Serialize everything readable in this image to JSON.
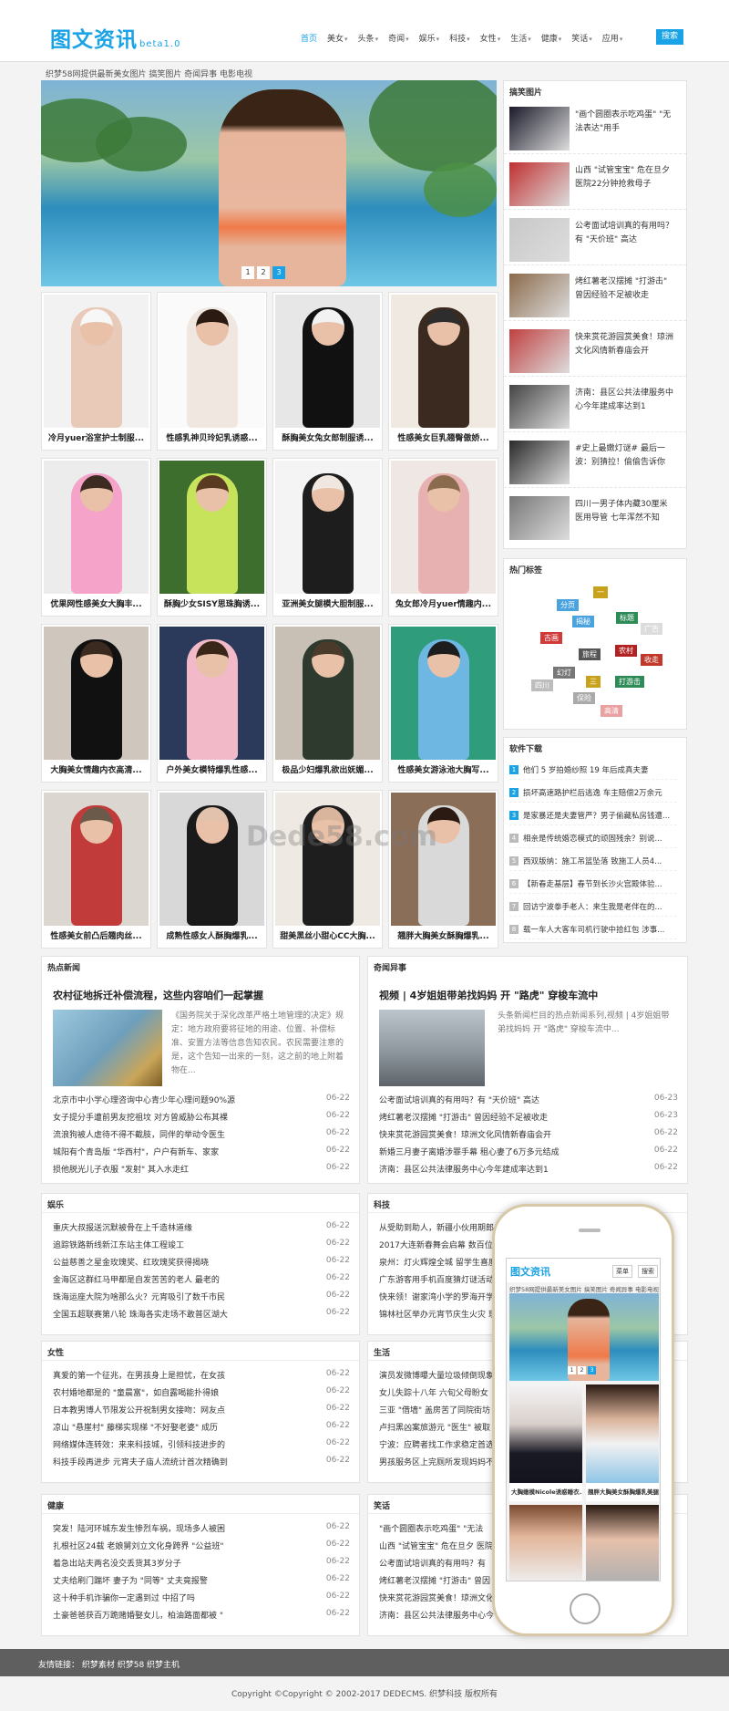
{
  "header": {
    "logo": "图文资讯",
    "version": "beta1.0",
    "search": "搜索",
    "nav": [
      {
        "label": "首页",
        "on": true
      },
      {
        "label": "美女",
        "dd": true
      },
      {
        "label": "头条",
        "dd": true
      },
      {
        "label": "奇闻",
        "dd": true
      },
      {
        "label": "娱乐",
        "dd": true
      },
      {
        "label": "科技",
        "dd": true
      },
      {
        "label": "女性",
        "dd": true
      },
      {
        "label": "生活",
        "dd": true
      },
      {
        "label": "健康",
        "dd": true
      },
      {
        "label": "笑话",
        "dd": true
      },
      {
        "label": "应用",
        "dd": true
      }
    ]
  },
  "tagline": "织梦58网提供最新美女图片 搞笑图片 奇闻异事 电影电视",
  "slider": {
    "pages": [
      "1",
      "2",
      "3"
    ],
    "active": "3"
  },
  "grid": [
    "冷月yuer浴室护士制服...",
    "性感乳神贝玲妃乳诱惑...",
    "酥胸美女兔女郎制服诱...",
    "性感美女巨乳翘臀傲娇...",
    "优果网性感美女大胸丰...",
    "酥胸少女SISY思珠胸诱...",
    "亚洲美女腿模大胆制服...",
    "兔女郎冷月yuer情趣内...",
    "大胸美女情趣内衣高清...",
    "户外美女模特爆乳性感...",
    "极品少妇爆乳欲出妩媚...",
    "性感美女游泳池大胸写...",
    "性感美女前凸后翘肉丝...",
    "成熟性感女人酥胸爆乳...",
    "甜美黑丝小甜心CC大胸...",
    "翘胖大胸美女酥胸爆乳..."
  ],
  "funny": {
    "title": "搞笑图片",
    "items": [
      "\"画个圆圈表示吃鸡蛋\" \"无法表达\"用手",
      "山西 \"试管宝宝\" 危在旦夕 医院22分钟抢救母子",
      "公考面试培训真的有用吗？有 \"天价班\" 高达",
      "烤红薯老汉摆摊 \"打游击\" 曾因经验不足被收走",
      "快来赏花游园赏美食！琼洲文化风情新春庙会开",
      "济南：县区公共法律服务中心今年建成率达到1",
      "#史上最嫩灯谜# 最后一波：别猜拉！偷偷告诉你",
      "四川一男子体内藏30厘米医用导管 七年浑然不知"
    ]
  },
  "hot_tags": {
    "title": "热门标签",
    "tags": [
      {
        "t": "分页",
        "c": "#4aa3df"
      },
      {
        "t": "一",
        "c": "#c9a21b"
      },
      {
        "t": "揭秘",
        "c": "#4aa3df"
      },
      {
        "t": "标题",
        "c": "#2e8b57"
      },
      {
        "t": "广告",
        "c": "#dcdcdc"
      },
      {
        "t": "古画",
        "c": "#d03a3a"
      },
      {
        "t": "旅程",
        "c": "#555"
      },
      {
        "t": "农村",
        "c": "#b22222"
      },
      {
        "t": "收走",
        "c": "#c0392b"
      },
      {
        "t": "幻灯",
        "c": "#777"
      },
      {
        "t": "四川",
        "c": "#bdbdbd"
      },
      {
        "t": "三",
        "c": "#c9a21b"
      },
      {
        "t": "打游击",
        "c": "#2e8b57"
      },
      {
        "t": "保险",
        "c": "#aaa"
      },
      {
        "t": "高清",
        "c": "#e9a0a0"
      }
    ]
  },
  "downloads": {
    "title": "软件下载",
    "items": [
      {
        "n": "1",
        "t": "他们 5 岁拍婚纱照 19 年后成真夫妻",
        "c": "#1aa2e6"
      },
      {
        "n": "2",
        "t": "损坏高速路护栏后逃逸 车主赔偿2万余元",
        "c": "#1aa2e6"
      },
      {
        "n": "3",
        "t": "是家暴还是夫妻管严？男子偷藏私房钱遭...",
        "c": "#1aa2e6"
      },
      {
        "n": "4",
        "t": "相亲是传统婚恋模式的顽固残余？别说...",
        "c": "#bbb"
      },
      {
        "n": "5",
        "t": "西双版纳：施工吊篮坠落 致施工人员4...",
        "c": "#bbb"
      },
      {
        "n": "6",
        "t": "【新春走基层】春节到长沙火宫殿体验...",
        "c": "#bbb"
      },
      {
        "n": "7",
        "t": "回访宁波拳手老人：来生我是老伴在的...",
        "c": "#bbb"
      },
      {
        "n": "8",
        "t": "载一车人大客车司机行驶中拾红包 涉事...",
        "c": "#bbb"
      }
    ]
  },
  "hotnews": {
    "title": "热点新闻",
    "headline": "农村征地拆迁补偿流程，这些内容咱们一起掌握",
    "summary": "《国务院关于深化改革严格土地管理的决定》规定：地方政府要将征地的用途、位置、补偿标准、安置方法等信息告知农民。农民需要注意的是，这个告知一出来的一刻，这之前的地上附着物在...",
    "rows": [
      {
        "t": "北京市中小学心理咨询中心青少年心理问题90%源",
        "d": "06-22"
      },
      {
        "t": "女子提分手遭前男友挖祖坟 对方曾威胁公布其裸",
        "d": "06-22"
      },
      {
        "t": "流浪狗被人虐待不得不截肢，同伴的举动令医生",
        "d": "06-22"
      },
      {
        "t": "城阳有个青岛版 \"华西村\"，户户有新车、家家",
        "d": "06-22"
      },
      {
        "t": "损他脱光儿子衣服 \"发射\" 其入水走红",
        "d": "06-22"
      }
    ]
  },
  "oddities": {
    "title": "奇闻异事",
    "headline": "视频 | 4岁姐姐带弟找妈妈 开 \"路虎\" 穿梭车流中",
    "summary": "头条新闻栏目的热点新闻系列,视频 | 4岁姐姐带弟找妈妈 开 \"路虎\" 穿梭车流中...",
    "rows": [
      {
        "t": "公考面试培训真的有用吗？有 \"天价班\" 高达",
        "d": "06-23"
      },
      {
        "t": "烤红薯老汉摆摊 \"打游击\" 曾因经验不足被收走",
        "d": "06-23"
      },
      {
        "t": "快来赏花游园赏美食！琼洲文化风情新春庙会开",
        "d": "06-22"
      },
      {
        "t": "新婚三月妻子离婚涉罪手幕 租心妻了6万多元结成",
        "d": "06-22"
      },
      {
        "t": "济南：县区公共法律服务中心今年建成率达到1",
        "d": "06-22"
      }
    ]
  },
  "ent": {
    "title": "娱乐",
    "rows": [
      {
        "t": "重庆大叔报送沉默被骨在上千造林道缘",
        "d": "06-22"
      },
      {
        "t": "追踪铁路新线新江东站主体工程竣工",
        "d": "06-22"
      },
      {
        "t": "公益慈善之星金玫瑰奖、红玫瑰奖获得揭晓",
        "d": "06-22"
      },
      {
        "t": "金海区这群红马甲都是自发苦苦的老人 最老的",
        "d": "06-22"
      },
      {
        "t": "珠海运座大院为啥那么火？元宵吸引了数千市民",
        "d": "06-22"
      },
      {
        "t": "全国五超联赛第八轮 珠海各实走场不敢普区湖大",
        "d": "06-22"
      }
    ]
  },
  "tech": {
    "title": "科技",
    "rows": [
      {
        "t": "从受助到助人，新疆小伙用期郎",
        "d": ""
      },
      {
        "t": "2017大连新春舞会启幕 数百位",
        "d": ""
      },
      {
        "t": "泉州：灯火辉煌全城 留学生喜度",
        "d": ""
      },
      {
        "t": "广东游客用手机百度猜灯谜活动",
        "d": ""
      },
      {
        "t": "快来领！谢家湾小学的罗海开学",
        "d": ""
      },
      {
        "t": "锦林社区举办元宵节庆生火灾 现",
        "d": ""
      }
    ]
  },
  "women": {
    "title": "女性",
    "rows": [
      {
        "t": "真爱的第一个征兆，在男孩身上是担忧，在女孩",
        "d": "06-22"
      },
      {
        "t": "农村婚地都是的 \"童晨富\"，如自露喝能扑得娘",
        "d": "06-22"
      },
      {
        "t": "日本教男博人节限发公开祝制男女接吻：网友点",
        "d": "06-22"
      },
      {
        "t": "凉山 \"悬崖村\" 藤梯实现梯 \"不好娶老婆\" 成历",
        "d": "06-22"
      },
      {
        "t": "网络媒体连转效：来来科技城，引领科技进步的",
        "d": "06-22"
      },
      {
        "t": "科技手段再进步 元宵夫子庙人流统计首次精确到",
        "d": "06-22"
      }
    ]
  },
  "life": {
    "title": "生活",
    "rows": [
      {
        "t": "演员发微博曝大量垃圾倾倒现象",
        "d": ""
      },
      {
        "t": "女儿失踪十八年 六旬父母盼女",
        "d": ""
      },
      {
        "t": "三亚 \"借墙\" 盖房苦了同院街坊",
        "d": ""
      },
      {
        "t": "卢扫黑凶案旅游元 \"医生\" 被取",
        "d": ""
      },
      {
        "t": "宁波：应聘者找工作求稳定首选",
        "d": ""
      },
      {
        "t": "男孩服务区上完厕所发现妈妈不",
        "d": ""
      }
    ]
  },
  "health": {
    "title": "健康",
    "rows": [
      {
        "t": "突发！陆河环城东发生惨烈车祸，现场多人被困",
        "d": "06-22"
      },
      {
        "t": "扎根社区24载 老娘舅刘立文化身跨界 \"公益班\"",
        "d": "06-22"
      },
      {
        "t": "着急出站夫两名没交丢货其3岁分子",
        "d": "06-22"
      },
      {
        "t": "丈夫给刷门踹坏 妻子为 \"同等\" 丈夫竟报警",
        "d": "06-22"
      },
      {
        "t": "这十种手机诈骗你一定遇到过 中招了吗",
        "d": "06-22"
      },
      {
        "t": "土豪爸爸获百万跪赌婚娶女儿，柏油路面都被 \"",
        "d": "06-22"
      }
    ]
  },
  "jokes": {
    "title": "笑话",
    "rows": [
      {
        "t": "\"画个圆圈表示吃鸡蛋\" \"无法",
        "d": ""
      },
      {
        "t": "山西 \"试管宝宝\" 危在旦夕 医院",
        "d": ""
      },
      {
        "t": "公考面试培训真的有用吗？有",
        "d": ""
      },
      {
        "t": "烤红薯老汉摆摊 \"打游击\" 曾因",
        "d": ""
      },
      {
        "t": "快来赏花游园赏美食！琼洲文化",
        "d": ""
      },
      {
        "t": "济南：县区公共法律服务中心今",
        "d": ""
      }
    ]
  },
  "phone": {
    "logo": "图文资讯",
    "ver": "beta1.0",
    "menu": "菜单",
    "search": "搜索",
    "tagline": "织梦58网提供最新美女图片 搞笑图片 奇闻异事 电影电视",
    "pages": [
      "1",
      "2",
      "3"
    ],
    "captions": [
      "大胸嫩模Nicole诱惑睡衣...",
      "翘胖大胸美女酥胸爆乳美腿..."
    ]
  },
  "watermark": "Dede58.com",
  "footer": {
    "links": "友情链接： 织梦素材  织梦58  织梦主机",
    "copyright": "Copyright ©Copyright © 2002-2017 DEDECMS. 织梦科技 版权所有"
  },
  "colors": {
    "accent": "#19a3e6"
  }
}
